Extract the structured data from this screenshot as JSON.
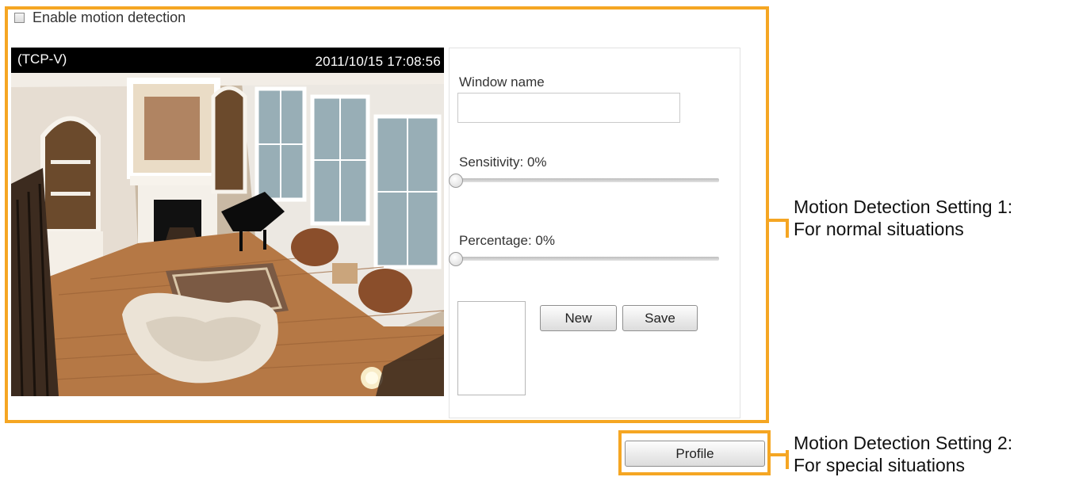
{
  "enable_motion": {
    "label": "Enable motion detection",
    "checked": false
  },
  "video": {
    "label": "(TCP-V)",
    "timestamp": "2011/10/15  17:08:56"
  },
  "settings": {
    "window_name_label": "Window name",
    "window_name_value": "",
    "sensitivity_label": "Sensitivity: 0%",
    "sensitivity_value": 0,
    "percentage_label": "Percentage: 0%",
    "percentage_value": 0,
    "new_label": "New",
    "save_label": "Save"
  },
  "profile_label": "Profile",
  "callouts": {
    "setting1_line1": "Motion Detection Setting 1:",
    "setting1_line2": "For normal situations",
    "setting2_line1": "Motion Detection Setting 2:",
    "setting2_line2": "For special situations"
  },
  "colors": {
    "callout_frame": "#f5a623"
  }
}
